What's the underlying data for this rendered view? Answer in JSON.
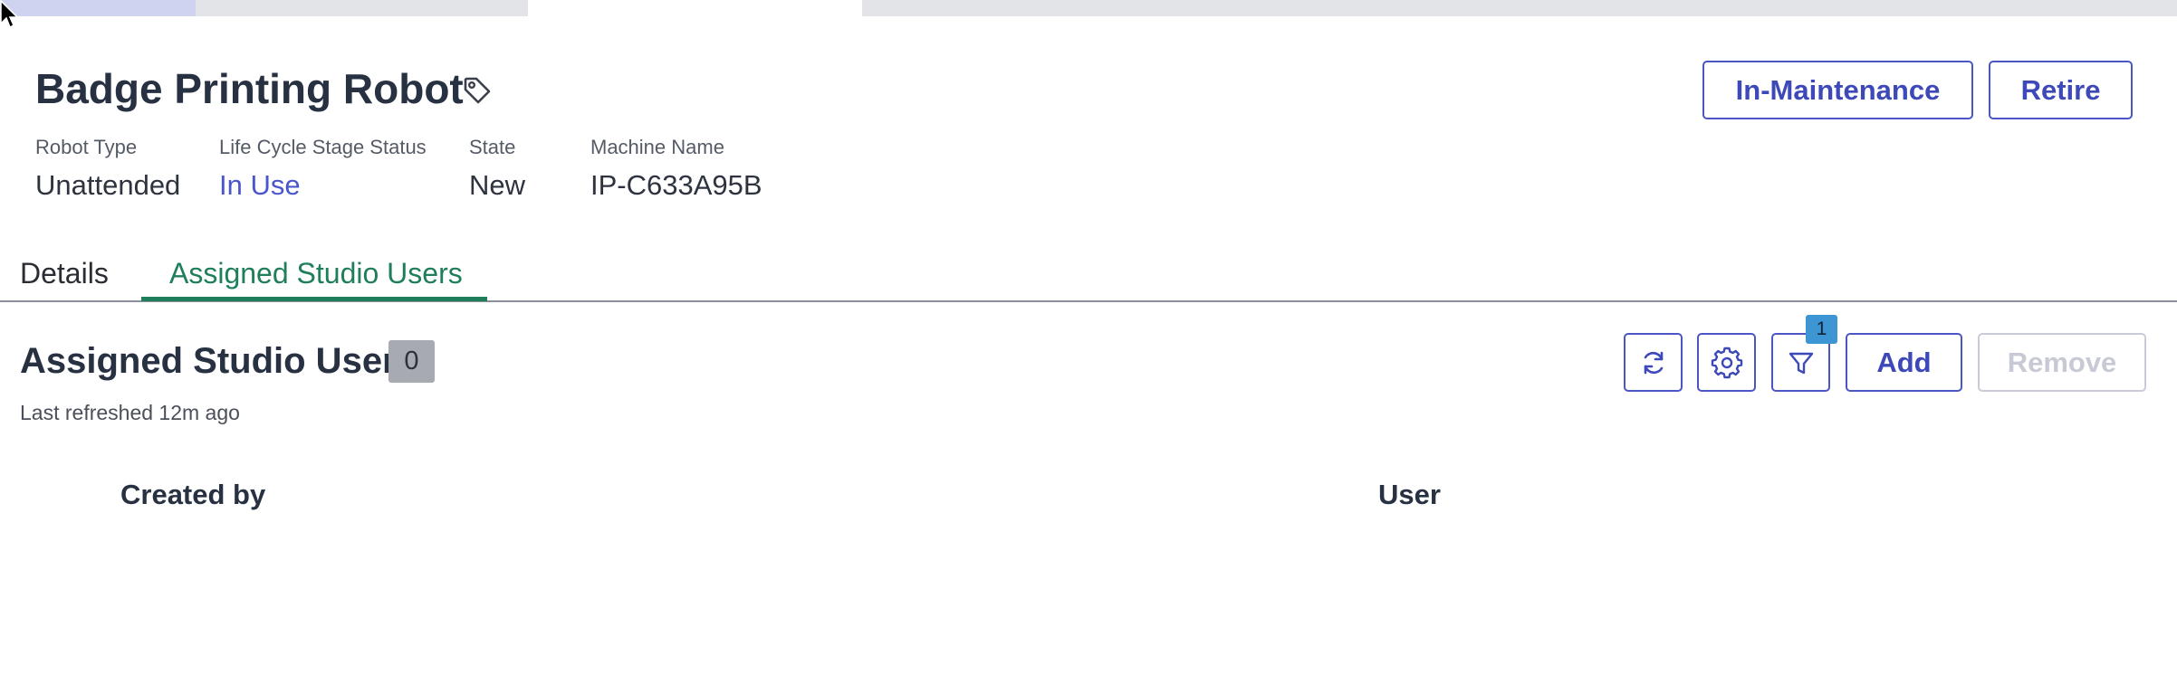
{
  "header": {
    "title": "Badge Printing Robot",
    "tag_icon": "tag-icon"
  },
  "meta": [
    {
      "label": "Robot Type",
      "value": "Unattended"
    },
    {
      "label": "Life Cycle Stage Status",
      "value": "In Use"
    },
    {
      "label": "State",
      "value": "New"
    },
    {
      "label": "Machine Name",
      "value": "IP-C633A95B"
    }
  ],
  "actions": {
    "in_maintenance_label": "In-Maintenance",
    "retire_label": "Retire"
  },
  "tabs": [
    {
      "label": "Details",
      "active": false
    },
    {
      "label": "Assigned Studio Users",
      "active": true
    }
  ],
  "section": {
    "title": "Assigned Studio Users",
    "count": "0",
    "last_refreshed": "Last refreshed 12m ago"
  },
  "toolbar": {
    "refresh_icon": "refresh-icon",
    "settings_icon": "gear-icon",
    "filter_icon": "filter-icon",
    "filter_count": "1",
    "add_label": "Add",
    "remove_label": "Remove"
  },
  "table": {
    "columns": [
      "Created by",
      "User"
    ],
    "rows": []
  },
  "colors": {
    "accent": "#4b55c4",
    "tab_active": "#1f7f5a",
    "link": "#4a57cc",
    "badge": "#3d95d3"
  }
}
